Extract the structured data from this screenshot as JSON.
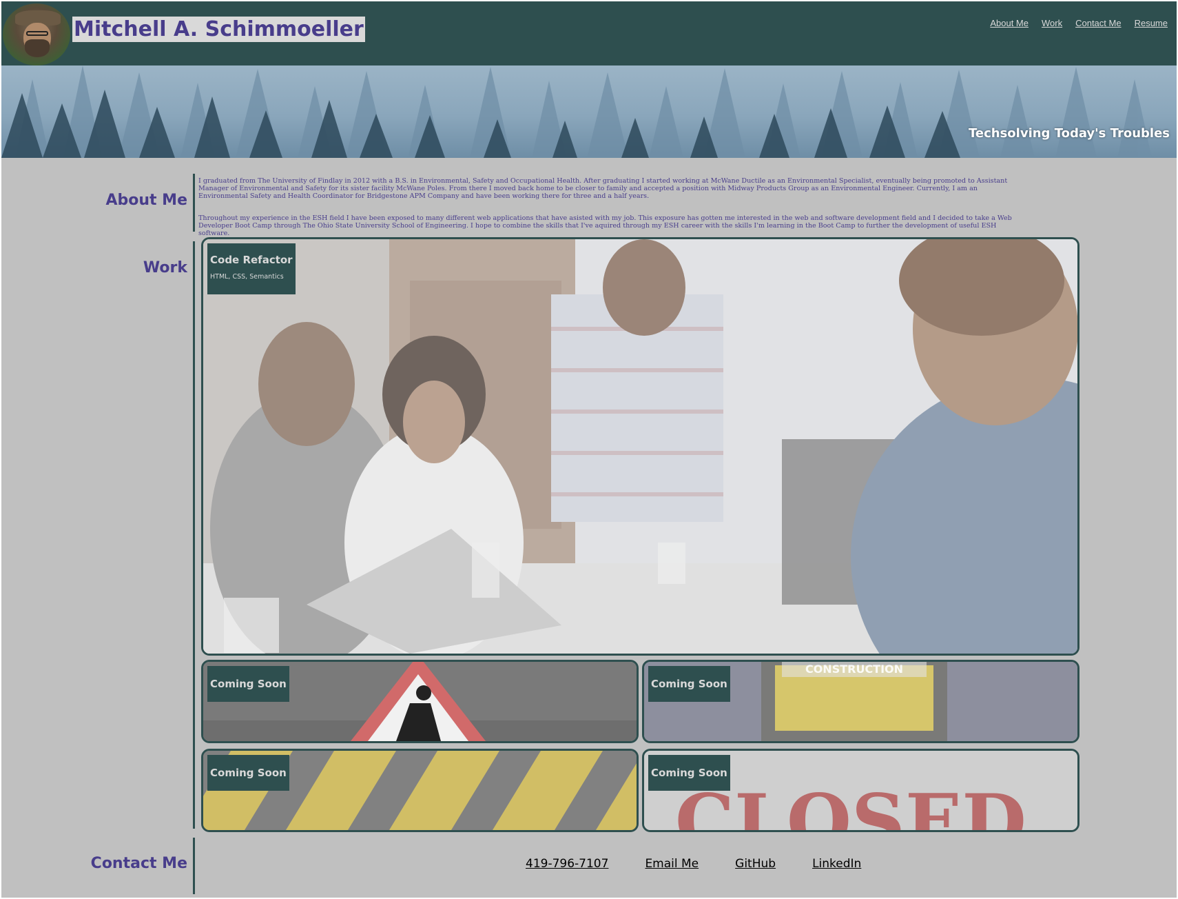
{
  "header": {
    "title": "Mitchell A. Schimmoeller",
    "nav": [
      "About Me",
      "Work",
      "Contact Me",
      "Resume"
    ]
  },
  "banner": {
    "tagline": "Techsolving Today's Troubles"
  },
  "about": {
    "heading": "About Me",
    "paragraphs": [
      "I graduated from The University of Findlay in 2012 with a B.S. in Environmental, Safety and Occupational Health. After graduating I started working at McWane Ductile as an Environmental Specialist, eventually being promoted to Assistant Manager of Environmental and Safety for its sister facility McWane Poles. From there I moved back home to be closer to family and accepted a position with Midway Products Group as an Environmental Engineer. Currently, I am an Environmental Safety and Health Coordinator for Bridgestone APM Company and have been working there for three and a half years.",
      "Throughout my experience in the ESH field I have been exposed to many different web applications that have asisted with my job. This exposure has gotten me interested in the web and software development field and I decided to take a Web Developer Boot Camp through The Ohio State University School of Engineering. I hope to combine the skills that I've aquired through my ESH career with the skills I'm learning in the Boot Camp to further the development of useful ESH software."
    ]
  },
  "work": {
    "heading": "Work",
    "featured": {
      "title": "Code Refactor",
      "tech": "HTML, CSS, Semantics"
    },
    "cards": [
      {
        "title": "Coming Soon",
        "image": "construction-sign"
      },
      {
        "title": "Coming Soon",
        "image": "construction-board"
      },
      {
        "title": "Coming Soon",
        "image": "hazard-stripes"
      },
      {
        "title": "Coming Soon",
        "image": "closed-sign"
      }
    ]
  },
  "contact": {
    "heading": "Contact Me",
    "links": [
      "419-796-7107",
      "Email Me",
      "GitHub",
      "LinkedIn"
    ]
  },
  "colors": {
    "header_bg": "#2e4f4f",
    "page_bg": "#c0c0c0",
    "heading": "#483d8b",
    "nav_link": "#d9d9d9"
  }
}
